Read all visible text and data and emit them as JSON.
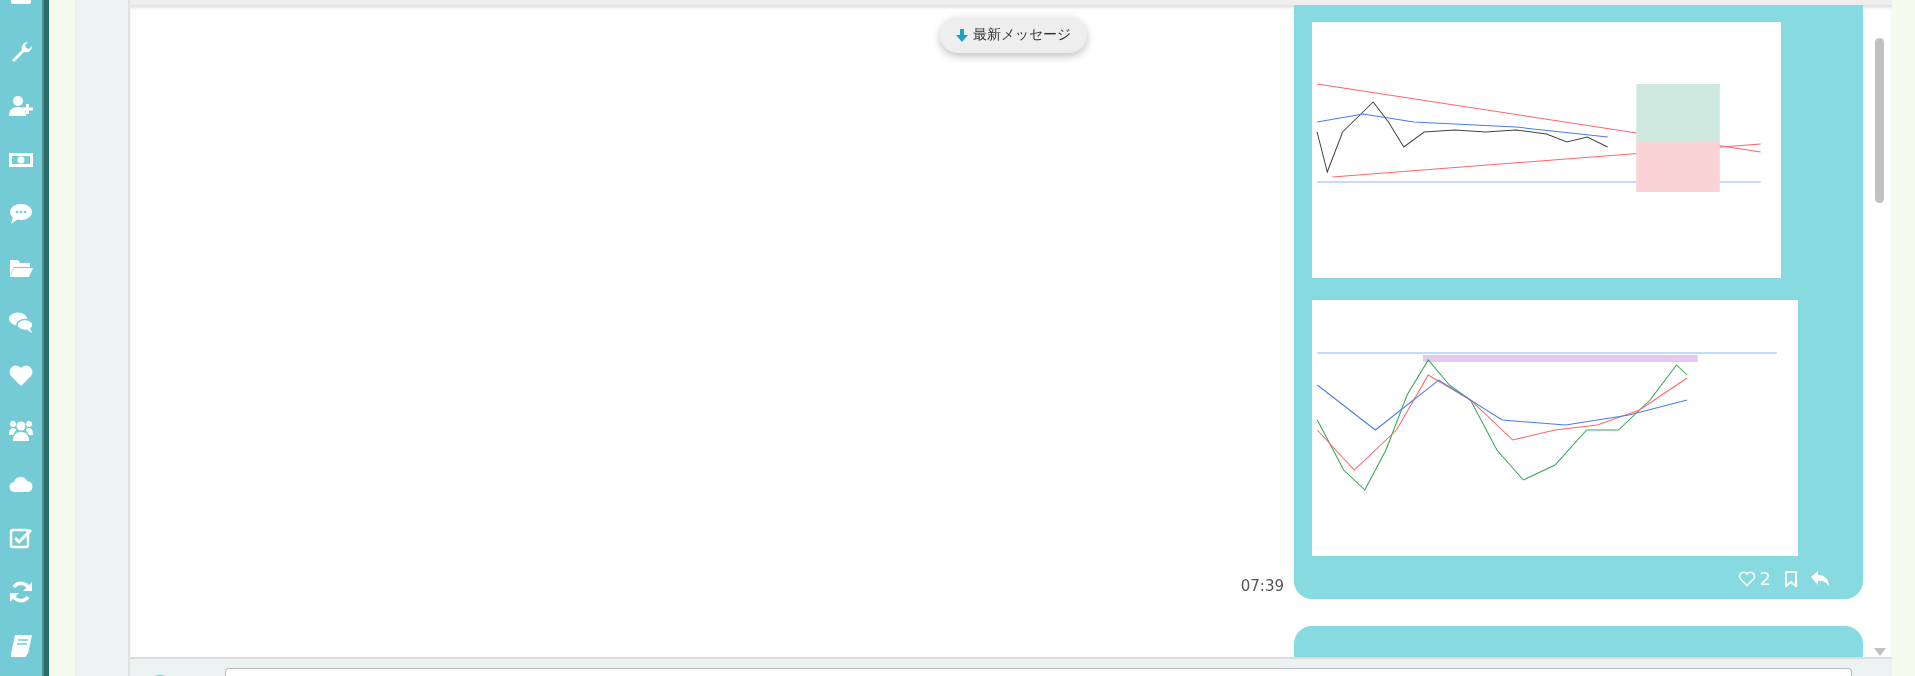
{
  "latest_button": {
    "label": "最新メッセージ"
  },
  "messages": [
    {
      "time": "07:39",
      "attachments": [
        {
          "kind": "chart_image"
        },
        {
          "kind": "chart_image"
        }
      ],
      "likes": "2"
    }
  ]
}
